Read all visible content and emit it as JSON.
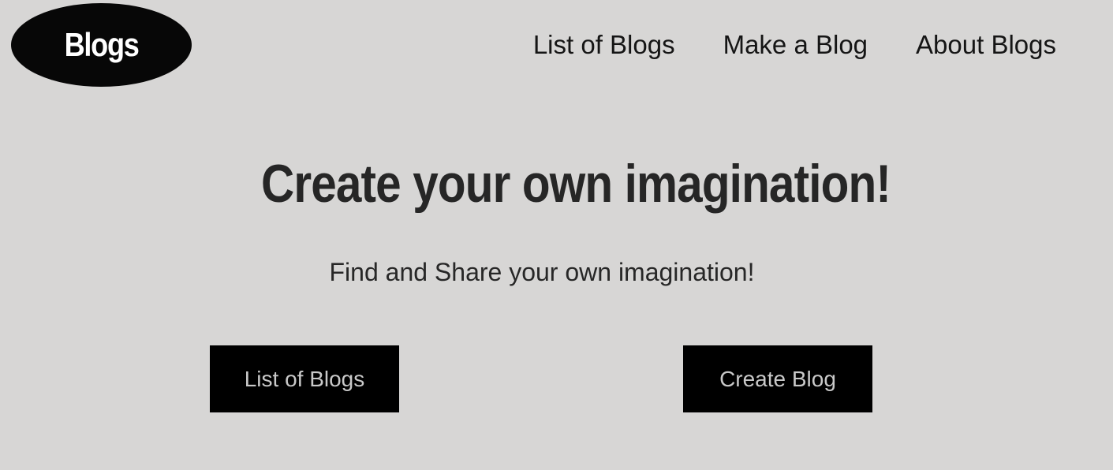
{
  "header": {
    "logo_text": "Blogs",
    "nav": [
      {
        "label": "List of Blogs"
      },
      {
        "label": "Make a Blog"
      },
      {
        "label": "About Blogs"
      }
    ]
  },
  "hero": {
    "title": "Create your own imagination!",
    "subtitle": "Find and Share your own imagination!"
  },
  "actions": {
    "list_label": "List of Blogs",
    "create_label": "Create Blog"
  },
  "colors": {
    "background": "#d7d6d5",
    "logo_bg": "#070707",
    "button_bg": "#000000",
    "button_text": "#c9c9c9"
  }
}
